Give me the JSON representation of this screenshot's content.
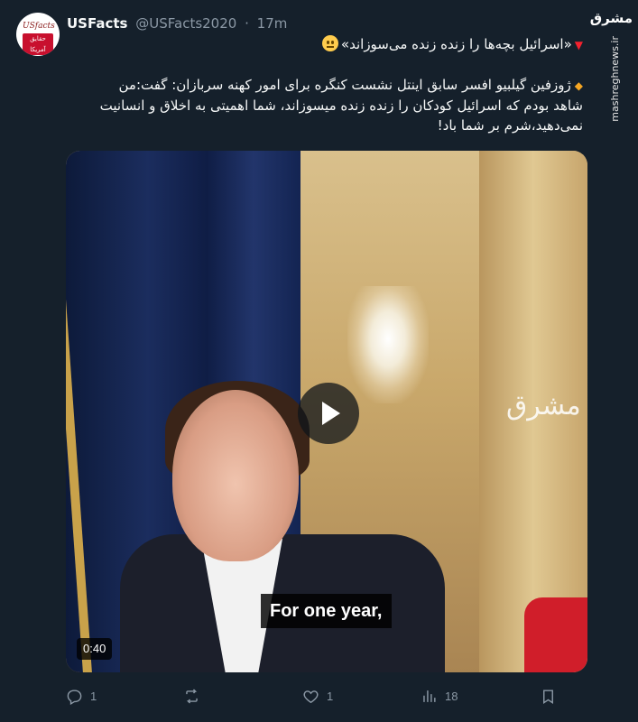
{
  "author": {
    "display_name": "USFacts",
    "handle": "@USFacts2020",
    "separator": "·",
    "time": "17m",
    "avatar_text": "USfacts",
    "avatar_subtext": "حقایق آمریکا"
  },
  "watermark": {
    "brand": "مشرق",
    "url": "mashreghnews.ir"
  },
  "tweet": {
    "title": "«اسرائیل بچه‌ها را زنده زنده می‌سوزاند»",
    "line1": "ژوزفین گیلبیو افسر سابق اینتل نشست کنگره برای امور کهنه سربازان: گفت:من",
    "line2": "شاهد بودم که اسرائیل کودکان را زنده زنده میسوزاند، شما اهمیتی به اخلاق و انسانیت",
    "line3": "نمی‌دهید،شرم بر شما باد!"
  },
  "media": {
    "caption": "For one year,",
    "duration": "0:40",
    "overlay_logo": "مشرق"
  },
  "actions": {
    "reply_count": "1",
    "retweet_count": "",
    "like_count": "1",
    "views_count": "18"
  },
  "icons": [
    "reply-icon",
    "retweet-icon",
    "like-icon",
    "views-icon",
    "share-icon",
    "play-icon"
  ]
}
